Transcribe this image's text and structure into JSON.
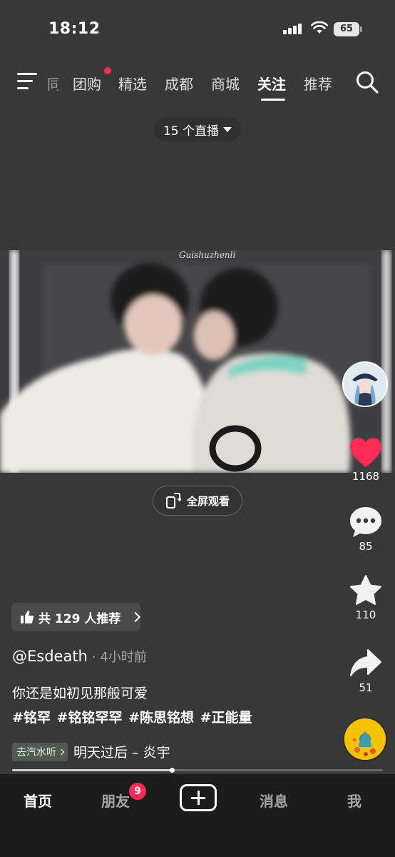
{
  "status_bar": {
    "time": "18:12",
    "battery": "65"
  },
  "top_nav": {
    "partial_tab": "同城",
    "tabs": [
      {
        "label": "团购",
        "active": false,
        "has_dot": true
      },
      {
        "label": "精选",
        "active": false
      },
      {
        "label": "成都",
        "active": false
      },
      {
        "label": "商城",
        "active": false
      },
      {
        "label": "关注",
        "active": true
      },
      {
        "label": "推荐",
        "active": false
      }
    ]
  },
  "live": {
    "label": "15 个直播"
  },
  "video": {
    "watermark": "Guishuzhenli"
  },
  "fullscreen": {
    "label": "全屏观看"
  },
  "right_rail": {
    "like_count": "1168",
    "comment_count": "85",
    "favorite_count": "110",
    "share_count": "51"
  },
  "post": {
    "recommend": "共 129 人推荐",
    "author": "@Esdeath",
    "time_ago": "· 4小时前",
    "caption": "你还是如初见那般可爱",
    "hashtags": "#铭罕 #铭铭罕罕 #陈思铭想 #正能量",
    "music_source": "去汽水听",
    "music_title": "明天过后 – 炎宇",
    "progress": 0.43
  },
  "bottom_tabs": {
    "home": "首页",
    "friends": "朋友",
    "friends_badge": "9",
    "messages": "消息",
    "me": "我"
  },
  "colors": {
    "like": "#fe2c55",
    "background": "#383838",
    "tabbar": "#1c1c1c"
  }
}
